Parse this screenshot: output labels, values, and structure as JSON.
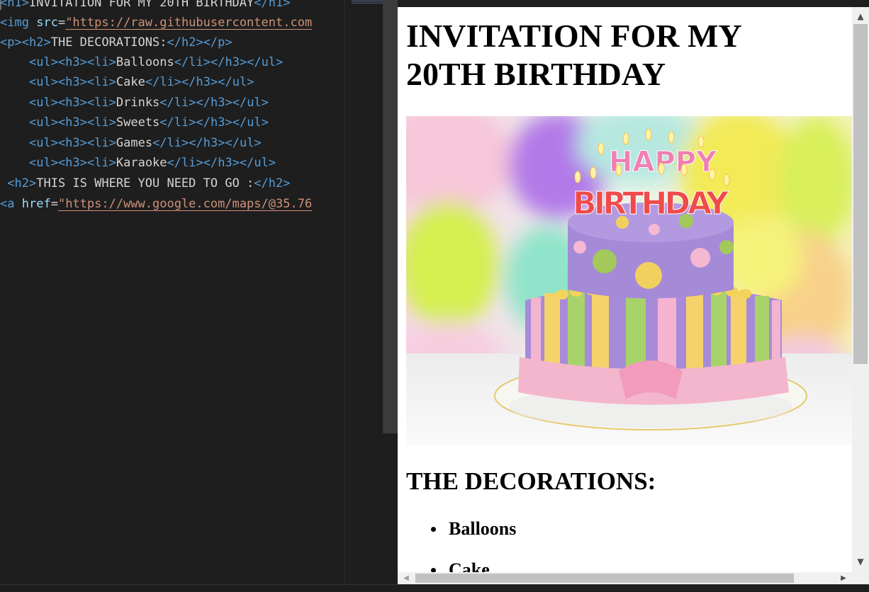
{
  "editor": {
    "lines": [
      {
        "parts": [
          [
            "tag",
            "<"
          ],
          [
            "tname",
            "h1"
          ],
          [
            "tag",
            ">"
          ],
          [
            "txt",
            "INVITATION FOR MY 20TH BIRTHDAY"
          ],
          [
            "tag",
            "</"
          ],
          [
            "tname",
            "h1"
          ],
          [
            "tag",
            ">"
          ]
        ]
      },
      {
        "parts": [
          [
            "tag",
            "<"
          ],
          [
            "tname",
            "img"
          ],
          [
            "txt",
            " "
          ],
          [
            "attr",
            "src"
          ],
          [
            "txt",
            "="
          ],
          [
            "str",
            "\"https://raw.githubusercontent.com"
          ]
        ]
      },
      {
        "parts": [
          [
            "tag",
            "<"
          ],
          [
            "tname",
            "p"
          ],
          [
            "tag",
            "><"
          ],
          [
            "tname",
            "h2"
          ],
          [
            "tag",
            ">"
          ],
          [
            "txt",
            "THE DECORATIONS:"
          ],
          [
            "tag",
            "</"
          ],
          [
            "tname",
            "h2"
          ],
          [
            "tag",
            "></"
          ],
          [
            "tname",
            "p"
          ],
          [
            "tag",
            ">"
          ]
        ]
      },
      {
        "parts": [
          [
            "txt",
            "    "
          ],
          [
            "tag",
            "<"
          ],
          [
            "tname",
            "ul"
          ],
          [
            "tag",
            "><"
          ],
          [
            "tname",
            "h3"
          ],
          [
            "tag",
            "><"
          ],
          [
            "tname",
            "li"
          ],
          [
            "tag",
            ">"
          ],
          [
            "txt",
            "Balloons"
          ],
          [
            "tag",
            "</"
          ],
          [
            "tname",
            "li"
          ],
          [
            "tag",
            "></"
          ],
          [
            "tname",
            "h3"
          ],
          [
            "tag",
            "></"
          ],
          [
            "tname",
            "ul"
          ],
          [
            "tag",
            ">"
          ]
        ]
      },
      {
        "parts": [
          [
            "txt",
            "    "
          ],
          [
            "tag",
            "<"
          ],
          [
            "tname",
            "ul"
          ],
          [
            "tag",
            "><"
          ],
          [
            "tname",
            "h3"
          ],
          [
            "tag",
            "><"
          ],
          [
            "tname",
            "li"
          ],
          [
            "tag",
            ">"
          ],
          [
            "txt",
            "Cake"
          ],
          [
            "tag",
            "</"
          ],
          [
            "tname",
            "li"
          ],
          [
            "tag",
            "></"
          ],
          [
            "tname",
            "h3"
          ],
          [
            "tag",
            "></"
          ],
          [
            "tname",
            "ul"
          ],
          [
            "tag",
            ">"
          ]
        ]
      },
      {
        "parts": [
          [
            "txt",
            "    "
          ],
          [
            "tag",
            "<"
          ],
          [
            "tname",
            "ul"
          ],
          [
            "tag",
            "><"
          ],
          [
            "tname",
            "h3"
          ],
          [
            "tag",
            "><"
          ],
          [
            "tname",
            "li"
          ],
          [
            "tag",
            ">"
          ],
          [
            "txt",
            "Drinks"
          ],
          [
            "tag",
            "</"
          ],
          [
            "tname",
            "li"
          ],
          [
            "tag",
            "></"
          ],
          [
            "tname",
            "h3"
          ],
          [
            "tag",
            "></"
          ],
          [
            "tname",
            "ul"
          ],
          [
            "tag",
            ">"
          ]
        ]
      },
      {
        "parts": [
          [
            "txt",
            "    "
          ],
          [
            "tag",
            "<"
          ],
          [
            "tname",
            "ul"
          ],
          [
            "tag",
            "><"
          ],
          [
            "tname",
            "h3"
          ],
          [
            "tag",
            "><"
          ],
          [
            "tname",
            "li"
          ],
          [
            "tag",
            ">"
          ],
          [
            "txt",
            "Sweets"
          ],
          [
            "tag",
            "</"
          ],
          [
            "tname",
            "li"
          ],
          [
            "tag",
            "></"
          ],
          [
            "tname",
            "h3"
          ],
          [
            "tag",
            "></"
          ],
          [
            "tname",
            "ul"
          ],
          [
            "tag",
            ">"
          ]
        ]
      },
      {
        "parts": [
          [
            "txt",
            "    "
          ],
          [
            "tag",
            "<"
          ],
          [
            "tname",
            "ul"
          ],
          [
            "tag",
            "><"
          ],
          [
            "tname",
            "h3"
          ],
          [
            "tag",
            "><"
          ],
          [
            "tname",
            "li"
          ],
          [
            "tag",
            ">"
          ],
          [
            "txt",
            "Games"
          ],
          [
            "tag",
            "</"
          ],
          [
            "tname",
            "li"
          ],
          [
            "tag",
            "></"
          ],
          [
            "tname",
            "h3"
          ],
          [
            "tag",
            "></"
          ],
          [
            "tname",
            "ul"
          ],
          [
            "tag",
            ">"
          ]
        ]
      },
      {
        "parts": [
          [
            "txt",
            "    "
          ],
          [
            "tag",
            "<"
          ],
          [
            "tname",
            "ul"
          ],
          [
            "tag",
            "><"
          ],
          [
            "tname",
            "h3"
          ],
          [
            "tag",
            "><"
          ],
          [
            "tname",
            "li"
          ],
          [
            "tag",
            ">"
          ],
          [
            "txt",
            "Karaoke"
          ],
          [
            "tag",
            "</"
          ],
          [
            "tname",
            "li"
          ],
          [
            "tag",
            "></"
          ],
          [
            "tname",
            "h3"
          ],
          [
            "tag",
            "></"
          ],
          [
            "tname",
            "ul"
          ],
          [
            "tag",
            ">"
          ]
        ]
      },
      {
        "parts": [
          [
            "txt",
            " "
          ],
          [
            "tag",
            "<"
          ],
          [
            "tname",
            "h2"
          ],
          [
            "tag",
            ">"
          ],
          [
            "txt",
            "THIS IS WHERE YOU NEED TO GO :"
          ],
          [
            "tag",
            "</"
          ],
          [
            "tname",
            "h2"
          ],
          [
            "tag",
            ">"
          ]
        ]
      },
      {
        "parts": [
          [
            "tag",
            "<"
          ],
          [
            "tname",
            "a"
          ],
          [
            "txt",
            " "
          ],
          [
            "attr",
            "href"
          ],
          [
            "txt",
            "="
          ],
          [
            "str",
            "\"https://www.google.com/maps/@35.76"
          ]
        ]
      }
    ]
  },
  "preview": {
    "title": "INVITATION FOR MY 20TH BIRTHDAY",
    "image_text_top": "HAPPY",
    "image_text_bottom": "BIRTHDAY",
    "decorations_heading": "THE DECORATIONS:",
    "decorations": [
      "Balloons",
      "Cake"
    ]
  },
  "colors": {
    "editor_bg": "#1e1e1e",
    "tag": "#569cd6",
    "attr": "#9cdcfe",
    "string": "#ce9178",
    "text": "#d4d4d4"
  }
}
